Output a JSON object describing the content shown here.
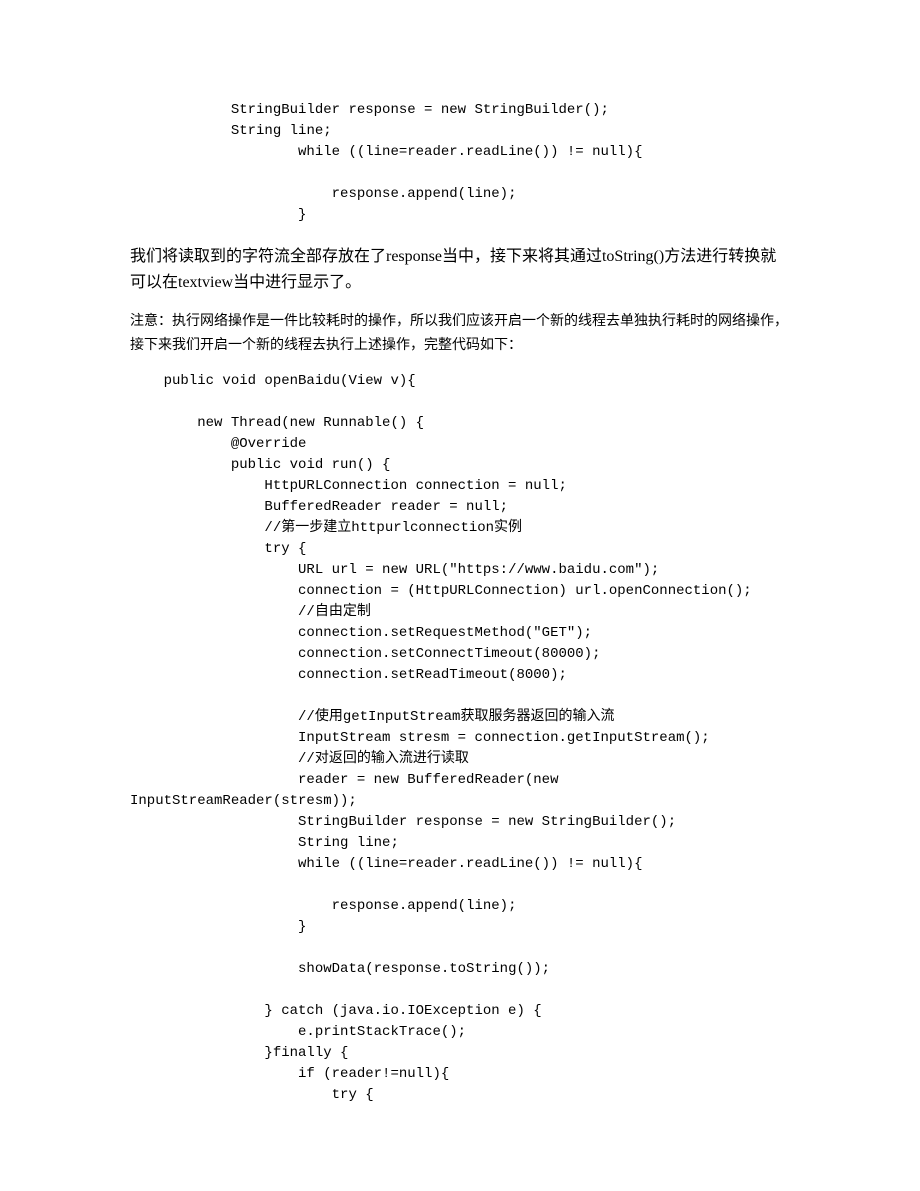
{
  "codeBlock1": "            StringBuilder response = new StringBuilder();\n            String line;\n                    while ((line=reader.readLine()) != null){\n\n                        response.append(line);\n                    }",
  "paragraph1": "我们将读取到的字符流全部存放在了response当中，接下来将其通过toString()方法进行转换就可以在textview当中进行显示了。",
  "paragraph2": "注意：执行网络操作是一件比较耗时的操作，所以我们应该开启一个新的线程去单独执行耗时的网络操作，接下来我们开启一个新的线程去执行上述操作，完整代码如下：",
  "codeBlock2": "    public void openBaidu(View v){\n\n        new Thread(new Runnable() {\n            @Override\n            public void run() {\n                HttpURLConnection connection = null;\n                BufferedReader reader = null;\n                //第一步建立httpurlconnection实例\n                try {\n                    URL url = new URL(\"https://www.baidu.com\");\n                    connection = (HttpURLConnection) url.openConnection();\n                    //自由定制\n                    connection.setRequestMethod(\"GET\");\n                    connection.setConnectTimeout(80000);\n                    connection.setReadTimeout(8000);\n\n                    //使用getInputStream获取服务器返回的输入流\n                    InputStream stresm = connection.getInputStream();\n                    //对返回的输入流进行读取\n                    reader = new BufferedReader(new InputStreamReader(stresm));\n                    StringBuilder response = new StringBuilder();\n                    String line;\n                    while ((line=reader.readLine()) != null){\n\n                        response.append(line);\n                    }\n\n                    showData(response.toString());\n\n                } catch (java.io.IOException e) {\n                    e.printStackTrace();\n                }finally {\n                    if (reader!=null){\n                        try {"
}
